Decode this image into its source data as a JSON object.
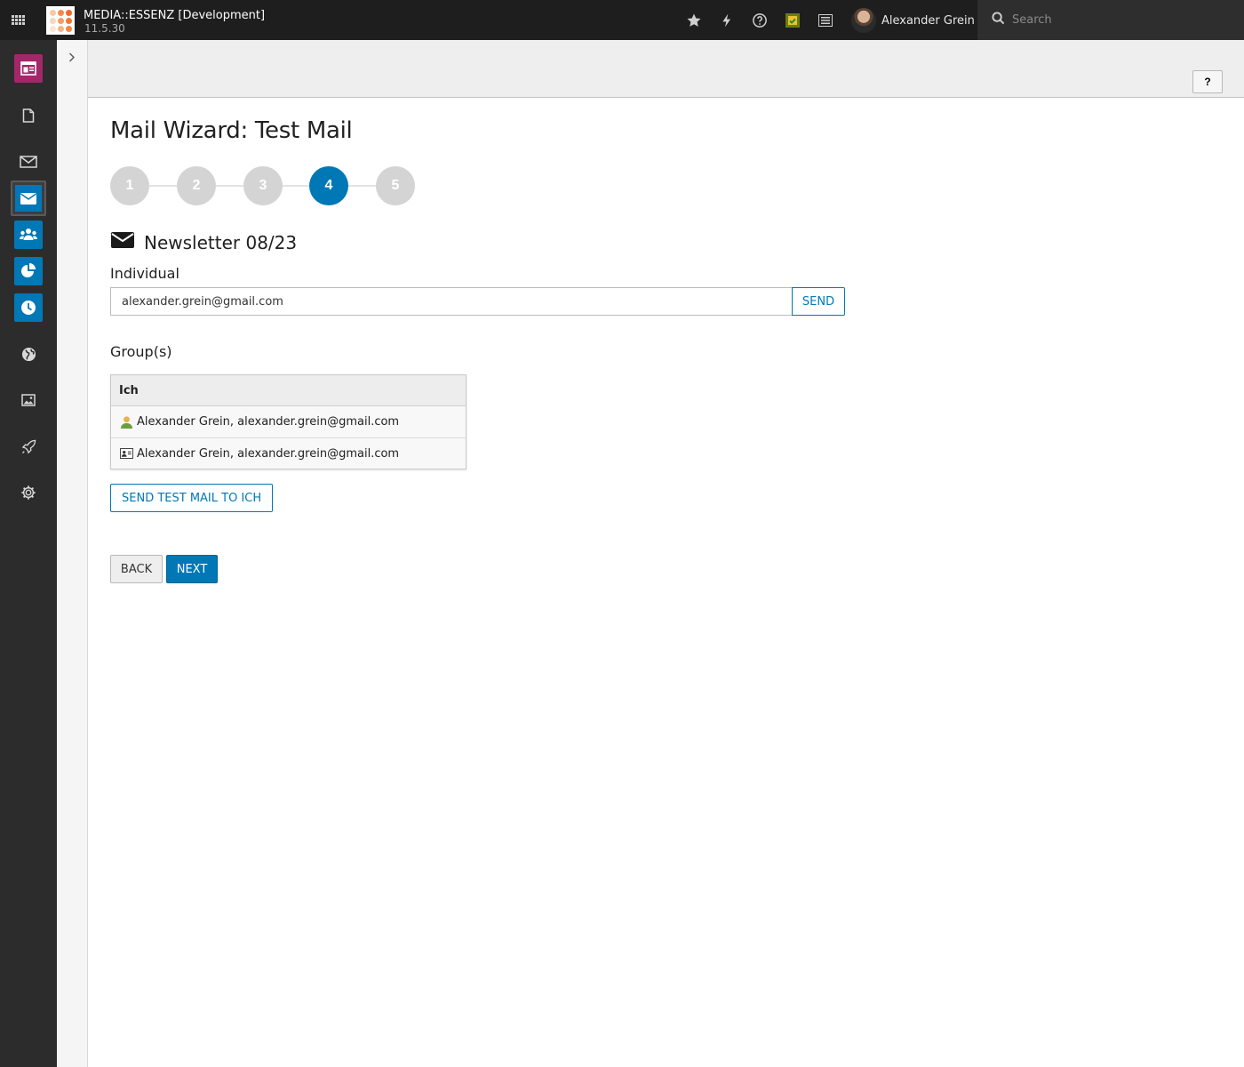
{
  "topbar": {
    "site_name": "MEDIA::ESSENZ [Development]",
    "site_version": "11.5.30",
    "icons": [
      "apps-grid-icon",
      "bookmark-star-icon",
      "flash-clear-cache-icon",
      "help-icon",
      "system-info-icon",
      "opendocs-list-icon"
    ],
    "user_name": "Alexander Grein",
    "search_placeholder": "Search"
  },
  "modules": [
    "web-layout-icon",
    "page-icon",
    "mail-icon",
    "direct-mail-icon",
    "recipients-icon",
    "statistics-pie-icon",
    "mailer-queue-clock-icon",
    "globe-icon",
    "image-icon",
    "rocket-icon",
    "gear-icon"
  ],
  "doc_header": {
    "help_label": "?"
  },
  "main": {
    "title": "Mail Wizard: Test Mail",
    "steps": [
      "1",
      "2",
      "3",
      "4",
      "5"
    ],
    "active_step": "4",
    "newsletter_title": "Newsletter 08/23",
    "individual_label": "Individual",
    "individual_value": "alexander.grein@gmail.com",
    "send_label": "SEND",
    "groups_label": "Group(s)",
    "group": {
      "name": "Ich",
      "rows": [
        {
          "icon": "be-user-icon",
          "text": "Alexander Grein, alexander.grein@gmail.com"
        },
        {
          "icon": "address-card-icon",
          "text": "Alexander Grein, alexander.grein@gmail.com"
        }
      ]
    },
    "send_test_label": "SEND TEST MAIL TO ICH",
    "back_label": "BACK",
    "next_label": "NEXT"
  },
  "colors": {
    "accent": "#0078b6",
    "module_pink": "#a4276a",
    "topbar": "#1e1e1e",
    "sidebar": "#2c2c2c"
  }
}
